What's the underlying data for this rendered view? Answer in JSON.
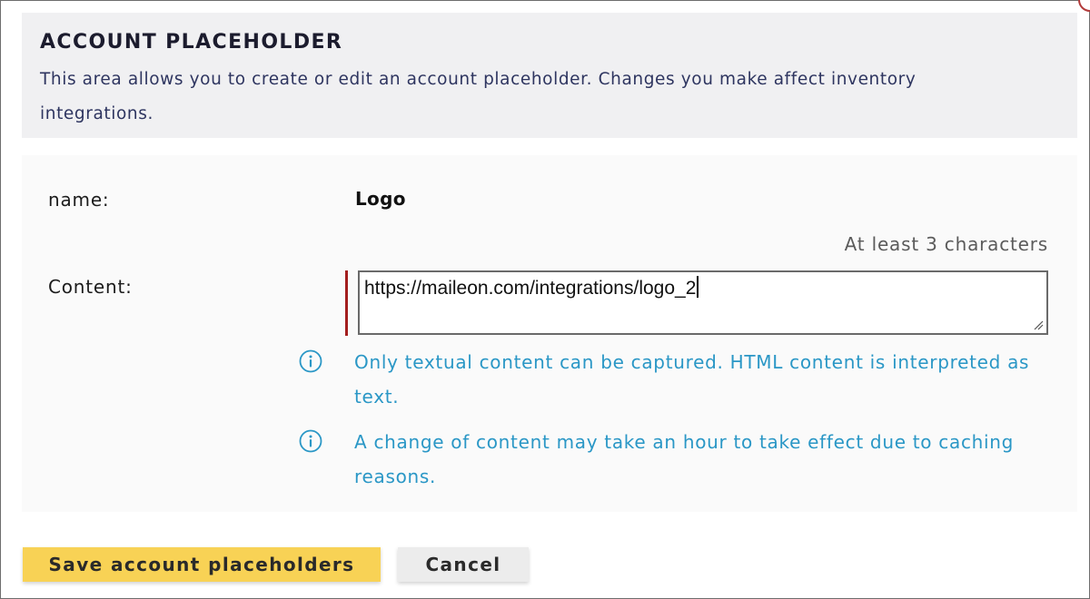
{
  "header": {
    "title": "ACCOUNT PLACEHOLDER",
    "description": "This area allows you to create or edit an account placeholder. Changes you make affect inventory integrations."
  },
  "form": {
    "name_label": "name:",
    "name_value": "Logo",
    "content_hint": "At least 3 characters",
    "content_label": "Content:",
    "content_value": "https://maileon.com/integrations/logo_2"
  },
  "info_notes": [
    {
      "icon": "info-icon",
      "text": "Only textual content can be captured. HTML content is interpreted as text."
    },
    {
      "icon": "info-icon",
      "text": "A change of content may take an hour to take effect due to caching reasons."
    }
  ],
  "buttons": {
    "save_label": "Save account placeholders",
    "cancel_label": "Cancel"
  },
  "colors": {
    "accent_save": "#f8d255",
    "info_text": "#2a97c6",
    "required_marker": "#a31e1e",
    "header_bg": "#f0f0f2"
  }
}
